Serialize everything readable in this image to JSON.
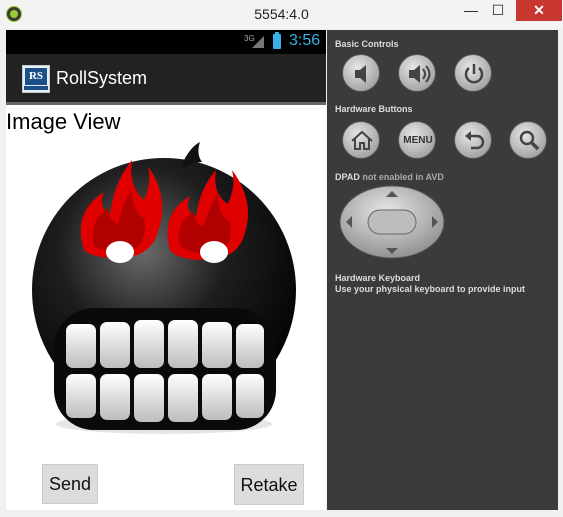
{
  "window": {
    "title": "5554:4.0",
    "min_label": "—",
    "max_label": "☐",
    "close_label": "✕"
  },
  "statusbar": {
    "network": "3G",
    "time": "3:56"
  },
  "actionbar": {
    "logo_text": "RS",
    "title": "RollSystem"
  },
  "content": {
    "heading": "Image View",
    "image_icon": "angry-face-flames-icon",
    "send_label": "Send",
    "retake_label": "Retake"
  },
  "panel": {
    "basic_controls_title": "Basic Controls",
    "basic_controls": [
      "volume-down-icon",
      "volume-up-icon",
      "power-icon"
    ],
    "hardware_buttons_title": "Hardware Buttons",
    "hardware_buttons": [
      "home-icon",
      "menu-button",
      "back-icon",
      "search-icon"
    ],
    "menu_label": "MENU",
    "dpad_title": "DPAD",
    "dpad_note": "not enabled in AVD",
    "keyboard_title": "Hardware Keyboard",
    "keyboard_text": "Use your physical keyboard to provide input"
  },
  "colors": {
    "statusbar_accent": "#33b5e5",
    "close_button": "#c7372f",
    "panel_bg": "#3b3b3b",
    "flame_red": "#e00000"
  }
}
